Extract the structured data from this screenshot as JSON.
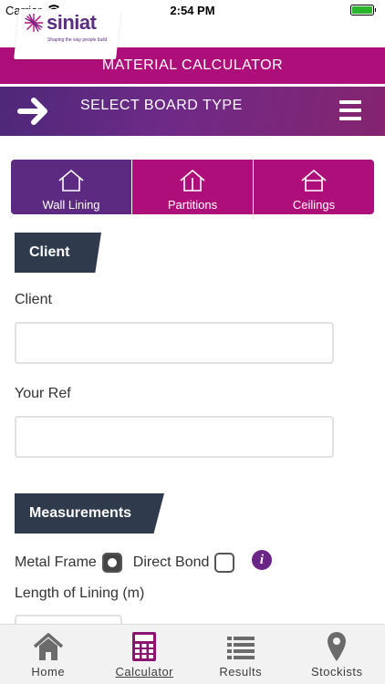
{
  "status_bar": {
    "carrier": "Carrier",
    "time": "2:54 PM"
  },
  "brand": {
    "logo_text": "siniat",
    "tagline": "Shaping the way people build",
    "accent": "#ae0e79",
    "purple": "#5d2a82"
  },
  "header": {
    "title": "MATERIAL CALCULATOR",
    "board_label": "SELECT BOARD TYPE"
  },
  "tabs": [
    {
      "label": "Wall Lining",
      "active": true
    },
    {
      "label": "Partitions",
      "active": false
    },
    {
      "label": "Ceilings",
      "active": false
    }
  ],
  "client_section": {
    "heading": "Client",
    "client_label": "Client",
    "client_value": "",
    "ref_label": "Your Ref",
    "ref_value": ""
  },
  "measurements_section": {
    "heading": "Measurements",
    "metal_frame_label": "Metal Frame",
    "metal_frame_checked": true,
    "direct_bond_label": "Direct Bond",
    "direct_bond_checked": false,
    "length_label": "Length of Lining (m)"
  },
  "bottom_nav": [
    {
      "label": "Home",
      "icon": "home-icon"
    },
    {
      "label": "Calculator",
      "icon": "calculator-icon",
      "active": true
    },
    {
      "label": "Results",
      "icon": "list-icon"
    },
    {
      "label": "Stockists",
      "icon": "map-pin-icon"
    }
  ]
}
